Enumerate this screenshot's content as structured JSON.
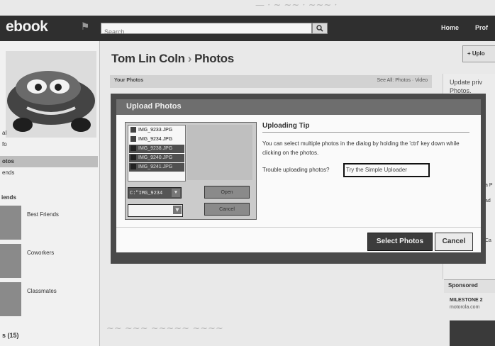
{
  "header": {
    "logo": "ebook",
    "search_placeholder": "Search",
    "home": "Home",
    "profile": "Prof"
  },
  "sidebar": {
    "items": [
      "al",
      "fo",
      "otos",
      "ends"
    ],
    "friends_heading": "iends",
    "friend_lists": [
      "Best Friends",
      "Coworkers",
      "Classmates"
    ],
    "photos_count": "s (15)"
  },
  "main": {
    "owner": "Tom Lin Coln",
    "section": "Photos",
    "your_photos": "Your Photos",
    "see_all": "See All: Photos · Video"
  },
  "right": {
    "upload_button": "+ Uplo",
    "update_privacy": [
      "Update priv",
      "Photos."
    ],
    "sponsored": "Sponsored",
    "ad_title": "MILESTONE 2",
    "ad_url": "motorola.com"
  },
  "modal": {
    "title": "Upload Photos",
    "files": [
      {
        "name": "IMG_9233.JPG",
        "selected": false
      },
      {
        "name": "IMG_9234.JPG",
        "selected": false
      },
      {
        "name": "IMG_9238.JPG",
        "selected": true
      },
      {
        "name": "IMG_9240.JPG",
        "selected": true
      },
      {
        "name": "IMG_9241.JPG",
        "selected": true
      }
    ],
    "filename_value": "C:\"IMG_9234",
    "open_button": "Open",
    "cancel_dialog_button": "Cancel",
    "tip_heading": "Uploading Tip",
    "tip_text": "You can select multiple photos in the dialog by holding the 'ctrl' key down while clicking on the photos.",
    "trouble_text": "Trouble uploading photos?",
    "simple_uploader_link": "Try the Simple Uploader",
    "select_photos_button": "Select Photos",
    "cancel_button": "Cancel"
  }
}
